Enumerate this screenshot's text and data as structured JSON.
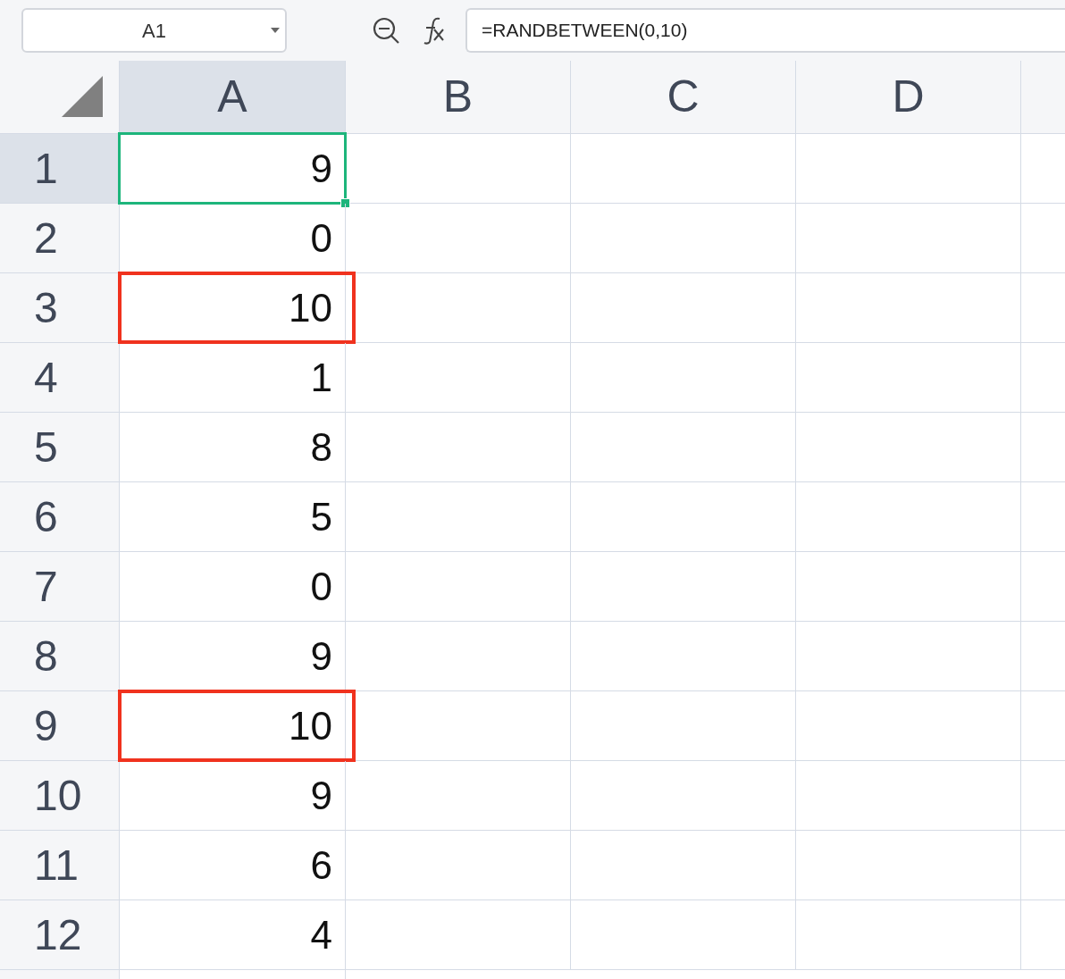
{
  "name_box": {
    "value": "A1"
  },
  "formula_bar": {
    "value": "=RANDBETWEEN(0,10)"
  },
  "columns": [
    {
      "label": "A",
      "selected": true
    },
    {
      "label": "B",
      "selected": false
    },
    {
      "label": "C",
      "selected": false
    },
    {
      "label": "D",
      "selected": false
    }
  ],
  "rows": [
    {
      "label": "1",
      "value": "9",
      "selected": true,
      "marked": false
    },
    {
      "label": "2",
      "value": "0",
      "selected": false,
      "marked": false
    },
    {
      "label": "3",
      "value": "10",
      "selected": false,
      "marked": true
    },
    {
      "label": "4",
      "value": "1",
      "selected": false,
      "marked": false
    },
    {
      "label": "5",
      "value": "8",
      "selected": false,
      "marked": false
    },
    {
      "label": "6",
      "value": "5",
      "selected": false,
      "marked": false
    },
    {
      "label": "7",
      "value": "0",
      "selected": false,
      "marked": false
    },
    {
      "label": "8",
      "value": "9",
      "selected": false,
      "marked": false
    },
    {
      "label": "9",
      "value": "10",
      "selected": false,
      "marked": true
    },
    {
      "label": "10",
      "value": "9",
      "selected": false,
      "marked": false
    },
    {
      "label": "11",
      "value": "6",
      "selected": false,
      "marked": false
    },
    {
      "label": "12",
      "value": "4",
      "selected": false,
      "marked": false
    }
  ]
}
